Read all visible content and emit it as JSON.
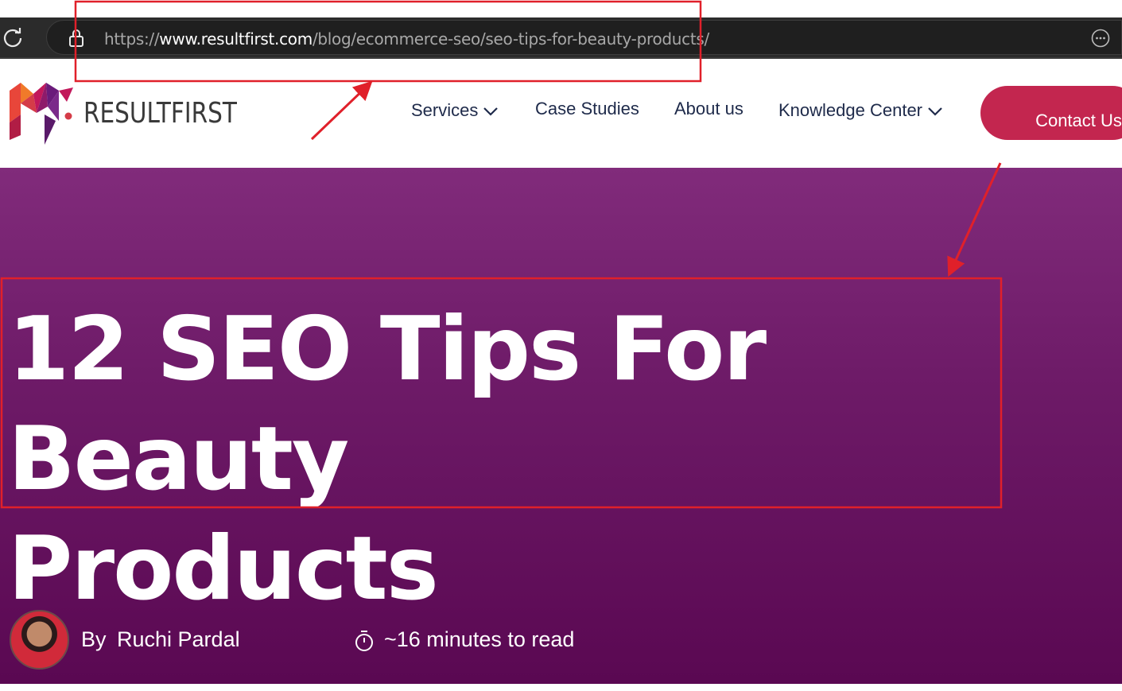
{
  "browser": {
    "url_scheme": "https://",
    "url_host": "www.resultfirst.com",
    "url_path": "/blog/ecommerce-seo/seo-tips-for-beauty-products/",
    "reload_icon": "reload-icon",
    "lock_icon": "lock-icon",
    "more_icon": "more-options-icon"
  },
  "header": {
    "logo_text": "RESULTFIRST",
    "nav": {
      "services": "Services",
      "case_studies": "Case Studies",
      "about": "About us",
      "knowledge": "Knowledge Center"
    },
    "contact_label": "Contact Us"
  },
  "hero": {
    "title_line1": "12 SEO Tips For Beauty",
    "title_line2": "Products",
    "by_label": "By",
    "author": "Ruchi Pardal",
    "read_time": "~16 minutes to read"
  },
  "colors": {
    "brand_accent": "#c3264f",
    "hero_top": "#812b7b",
    "hero_bottom": "#5a0852",
    "annotation": "#e0202a"
  }
}
